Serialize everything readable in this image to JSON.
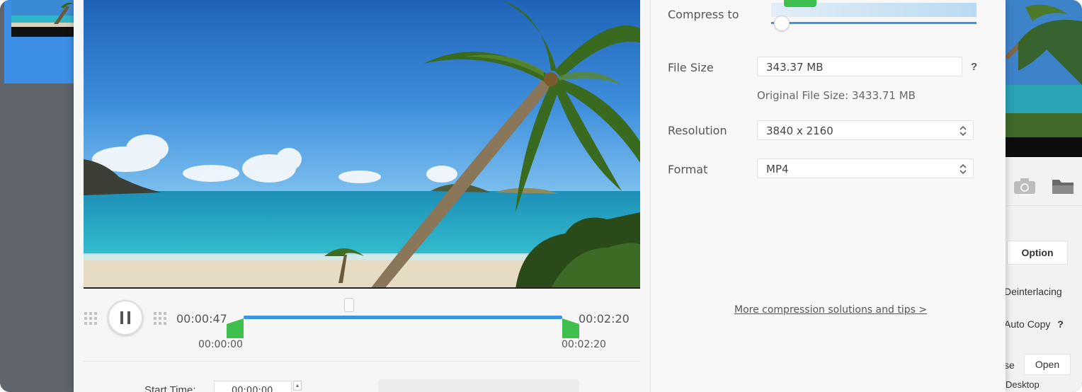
{
  "background_app": {
    "option_button": "Option",
    "deinterlacing_label": "Deinterlacing",
    "auto_copy_label": "Auto Copy",
    "auto_copy_help": "?",
    "browse_partial": "se",
    "open_button": "Open",
    "desktop_label": "Desktop",
    "camera_icon": "camera-icon",
    "folder_icon": "folder-icon"
  },
  "player": {
    "current_time": "00:00:47",
    "duration": "00:02:20",
    "trim_start": "00:00:00",
    "trim_end": "00:02:20",
    "start_time_label": "Start Time:",
    "start_time_value": "00:00:00",
    "pause_icon": "pause-icon"
  },
  "compress": {
    "compress_to_label": "Compress to",
    "compress_level": 0.05,
    "file_size_label": "File Size",
    "file_size_value": "343.37  MB",
    "help_icon": "?",
    "original_size_text": "Original File Size: 3433.71 MB",
    "resolution_label": "Resolution",
    "resolution_value": "3840 x 2160",
    "format_label": "Format",
    "format_value": "MP4",
    "more_link": "More compression solutions and tips >"
  },
  "colors": {
    "accent_blue": "#3a94e2",
    "trim_green": "#3fbf4e",
    "dialog_bg": "#f6f6f6"
  }
}
